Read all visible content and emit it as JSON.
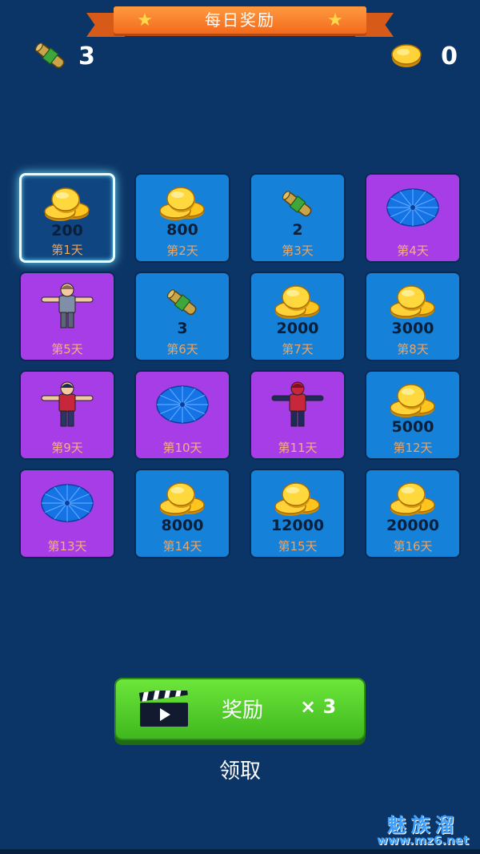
{
  "header": {
    "title": "每日奖励"
  },
  "counters": {
    "scrolls": "3",
    "coins": "0"
  },
  "days": [
    {
      "type": "coin",
      "amount": "200",
      "label": "第1天",
      "current": true
    },
    {
      "type": "coin",
      "amount": "800",
      "label": "第2天"
    },
    {
      "type": "scroll",
      "amount": "2",
      "label": "第3天"
    },
    {
      "type": "wheel",
      "amount": "",
      "label": "第4天"
    },
    {
      "type": "skin",
      "amount": "",
      "label": "第5天",
      "skin": "grey"
    },
    {
      "type": "scroll",
      "amount": "3",
      "label": "第6天"
    },
    {
      "type": "coin",
      "amount": "2000",
      "label": "第7天"
    },
    {
      "type": "coin",
      "amount": "3000",
      "label": "第8天"
    },
    {
      "type": "skin",
      "amount": "",
      "label": "第9天",
      "skin": "hero"
    },
    {
      "type": "wheel",
      "amount": "",
      "label": "第10天"
    },
    {
      "type": "skin",
      "amount": "",
      "label": "第11天",
      "skin": "red"
    },
    {
      "type": "coin",
      "amount": "5000",
      "label": "第12天"
    },
    {
      "type": "wheel",
      "amount": "",
      "label": "第13天"
    },
    {
      "type": "coin",
      "amount": "8000",
      "label": "第14天"
    },
    {
      "type": "coin",
      "amount": "12000",
      "label": "第15天"
    },
    {
      "type": "coin",
      "amount": "20000",
      "label": "第16天"
    }
  ],
  "claim": {
    "label": "奖励",
    "multiplier": "× 3",
    "link": "领取"
  },
  "watermark": {
    "text": "魅族溜",
    "url": "www.mz6.net"
  },
  "colors": {
    "background": "#0c3567",
    "tile_blue": "#1581d8",
    "tile_purple": "#a63de6",
    "button_green": "#4fcb28",
    "ribbon_orange": "#f47a24"
  }
}
